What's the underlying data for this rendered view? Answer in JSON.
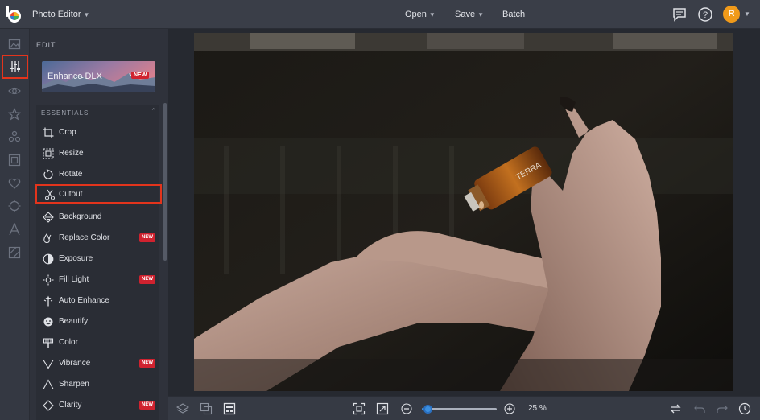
{
  "topbar": {
    "app_menu": "Photo Editor",
    "open_label": "Open",
    "save_label": "Save",
    "batch_label": "Batch",
    "avatar_initial": "R"
  },
  "rail": {
    "items": [
      "image-icon",
      "adjustments-icon",
      "eye-icon",
      "star-icon",
      "shapes-icon",
      "frame-icon",
      "heart-icon",
      "texture-icon",
      "text-icon",
      "overlay-icon"
    ],
    "active": "adjustments-icon"
  },
  "panel": {
    "title": "EDIT",
    "enhance": {
      "label": "Enhance DLX",
      "badge": "NEW"
    },
    "section_title": "ESSENTIALS",
    "tools": [
      {
        "label": "Crop",
        "icon": "crop-icon",
        "badge": ""
      },
      {
        "label": "Resize",
        "icon": "resize-icon",
        "badge": ""
      },
      {
        "label": "Rotate",
        "icon": "rotate-icon",
        "badge": ""
      },
      {
        "label": "Cutout",
        "icon": "scissors-icon",
        "badge": ""
      },
      {
        "label": "Background",
        "icon": "background-icon",
        "badge": ""
      },
      {
        "label": "Replace Color",
        "icon": "color-drop-icon",
        "badge": "NEW"
      },
      {
        "label": "Exposure",
        "icon": "exposure-icon",
        "badge": ""
      },
      {
        "label": "Fill Light",
        "icon": "fill-light-icon",
        "badge": "NEW"
      },
      {
        "label": "Auto Enhance",
        "icon": "magic-wand-icon",
        "badge": ""
      },
      {
        "label": "Beautify",
        "icon": "beautify-icon",
        "badge": ""
      },
      {
        "label": "Color",
        "icon": "color-icon",
        "badge": ""
      },
      {
        "label": "Vibrance",
        "icon": "vibrance-icon",
        "badge": "NEW"
      },
      {
        "label": "Sharpen",
        "icon": "sharpen-icon",
        "badge": ""
      },
      {
        "label": "Clarity",
        "icon": "clarity-icon",
        "badge": "NEW"
      }
    ]
  },
  "zoom": {
    "label": "25 %",
    "level": 0.07
  },
  "colors": {
    "accent": "#3b8fe0",
    "highlight": "#e3341c",
    "badge": "#d0222f",
    "avatar": "#f09a1a"
  }
}
